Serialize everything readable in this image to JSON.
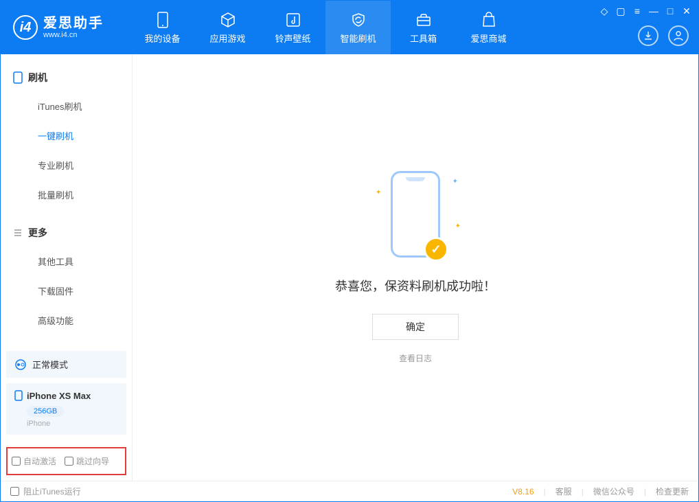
{
  "app": {
    "title": "爱思助手",
    "subtitle": "www.i4.cn"
  },
  "nav": {
    "items": [
      {
        "label": "我的设备"
      },
      {
        "label": "应用游戏"
      },
      {
        "label": "铃声壁纸"
      },
      {
        "label": "智能刷机"
      },
      {
        "label": "工具箱"
      },
      {
        "label": "爱思商城"
      }
    ]
  },
  "sidebar": {
    "section1": {
      "title": "刷机",
      "items": [
        "iTunes刷机",
        "一键刷机",
        "专业刷机",
        "批量刷机"
      ]
    },
    "section2": {
      "title": "更多",
      "items": [
        "其他工具",
        "下载固件",
        "高级功能"
      ]
    },
    "mode": "正常模式",
    "device": {
      "name": "iPhone XS Max",
      "storage": "256GB",
      "type": "iPhone"
    },
    "opts": {
      "auto_activate": "自动激活",
      "skip_wizard": "跳过向导"
    }
  },
  "main": {
    "success_text": "恭喜您，保资料刷机成功啦！",
    "ok_button": "确定",
    "view_log": "查看日志"
  },
  "footer": {
    "block_itunes": "阻止iTunes运行",
    "version": "V8.16",
    "links": [
      "客服",
      "微信公众号",
      "检查更新"
    ]
  }
}
